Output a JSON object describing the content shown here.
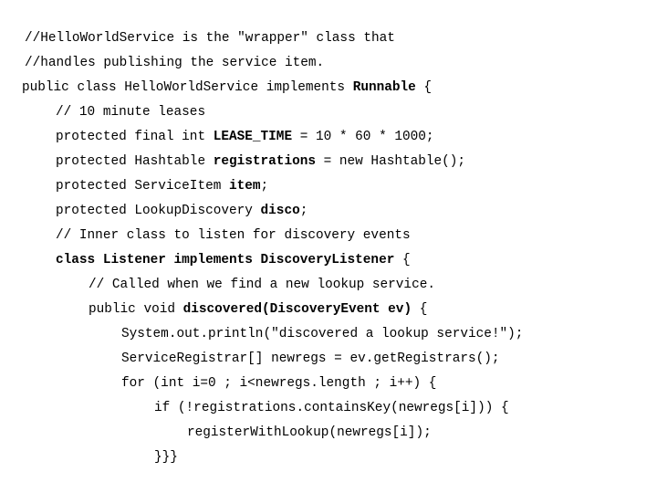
{
  "code": {
    "lines": [
      {
        "parts": [
          {
            "t": "//HelloWorldService is the \"wrapper\" class that",
            "b": false
          }
        ]
      },
      {
        "parts": [
          {
            "t": "//handles publishing the service item.",
            "b": false
          }
        ]
      },
      {
        "parts": [
          {
            "t": "public class HelloWorldService implements ",
            "b": false
          },
          {
            "t": "Runnable",
            "b": true
          },
          {
            "t": " {",
            "b": false
          }
        ]
      },
      {
        "parts": [
          {
            "t": "// 10 minute leases",
            "b": false
          }
        ]
      },
      {
        "parts": [
          {
            "t": "protected final int ",
            "b": false
          },
          {
            "t": "LEASE_TIME",
            "b": true
          },
          {
            "t": " = 10 * 60 * 1000;",
            "b": false
          }
        ]
      },
      {
        "parts": [
          {
            "t": "protected Hashtable ",
            "b": false
          },
          {
            "t": "registrations",
            "b": true
          },
          {
            "t": " = new Hashtable();",
            "b": false
          }
        ]
      },
      {
        "parts": [
          {
            "t": "protected ServiceItem ",
            "b": false
          },
          {
            "t": "item",
            "b": true
          },
          {
            "t": ";",
            "b": false
          }
        ]
      },
      {
        "parts": [
          {
            "t": "protected LookupDiscovery ",
            "b": false
          },
          {
            "t": "disco",
            "b": true
          },
          {
            "t": ";",
            "b": false
          }
        ]
      },
      {
        "parts": [
          {
            "t": "// Inner class to listen for discovery events",
            "b": false
          }
        ]
      },
      {
        "parts": [
          {
            "t": "class Listener implements DiscoveryListener",
            "b": true
          },
          {
            "t": " {",
            "b": false
          }
        ]
      },
      {
        "parts": [
          {
            "t": "// Called when we find a new lookup service.",
            "b": false
          }
        ]
      },
      {
        "parts": [
          {
            "t": "public void ",
            "b": false
          },
          {
            "t": "discovered(DiscoveryEvent ev)",
            "b": true
          },
          {
            "t": " {",
            "b": false
          }
        ]
      },
      {
        "parts": [
          {
            "t": "System.out.println(\"discovered a lookup service!\");",
            "b": false
          }
        ]
      },
      {
        "parts": [
          {
            "t": "ServiceRegistrar[] newregs = ev.getRegistrars();",
            "b": false
          }
        ]
      },
      {
        "parts": [
          {
            "t": "for (int i=0 ; i<newregs.length ; i++) {",
            "b": false
          }
        ]
      },
      {
        "parts": [
          {
            "t": "if (!registrations.containsKey(newregs[i])) {",
            "b": false
          }
        ]
      },
      {
        "parts": [
          {
            "t": "registerWithLookup(newregs[i]);",
            "b": false
          }
        ]
      },
      {
        "parts": [
          {
            "t": "}}}",
            "b": false
          }
        ]
      }
    ]
  }
}
